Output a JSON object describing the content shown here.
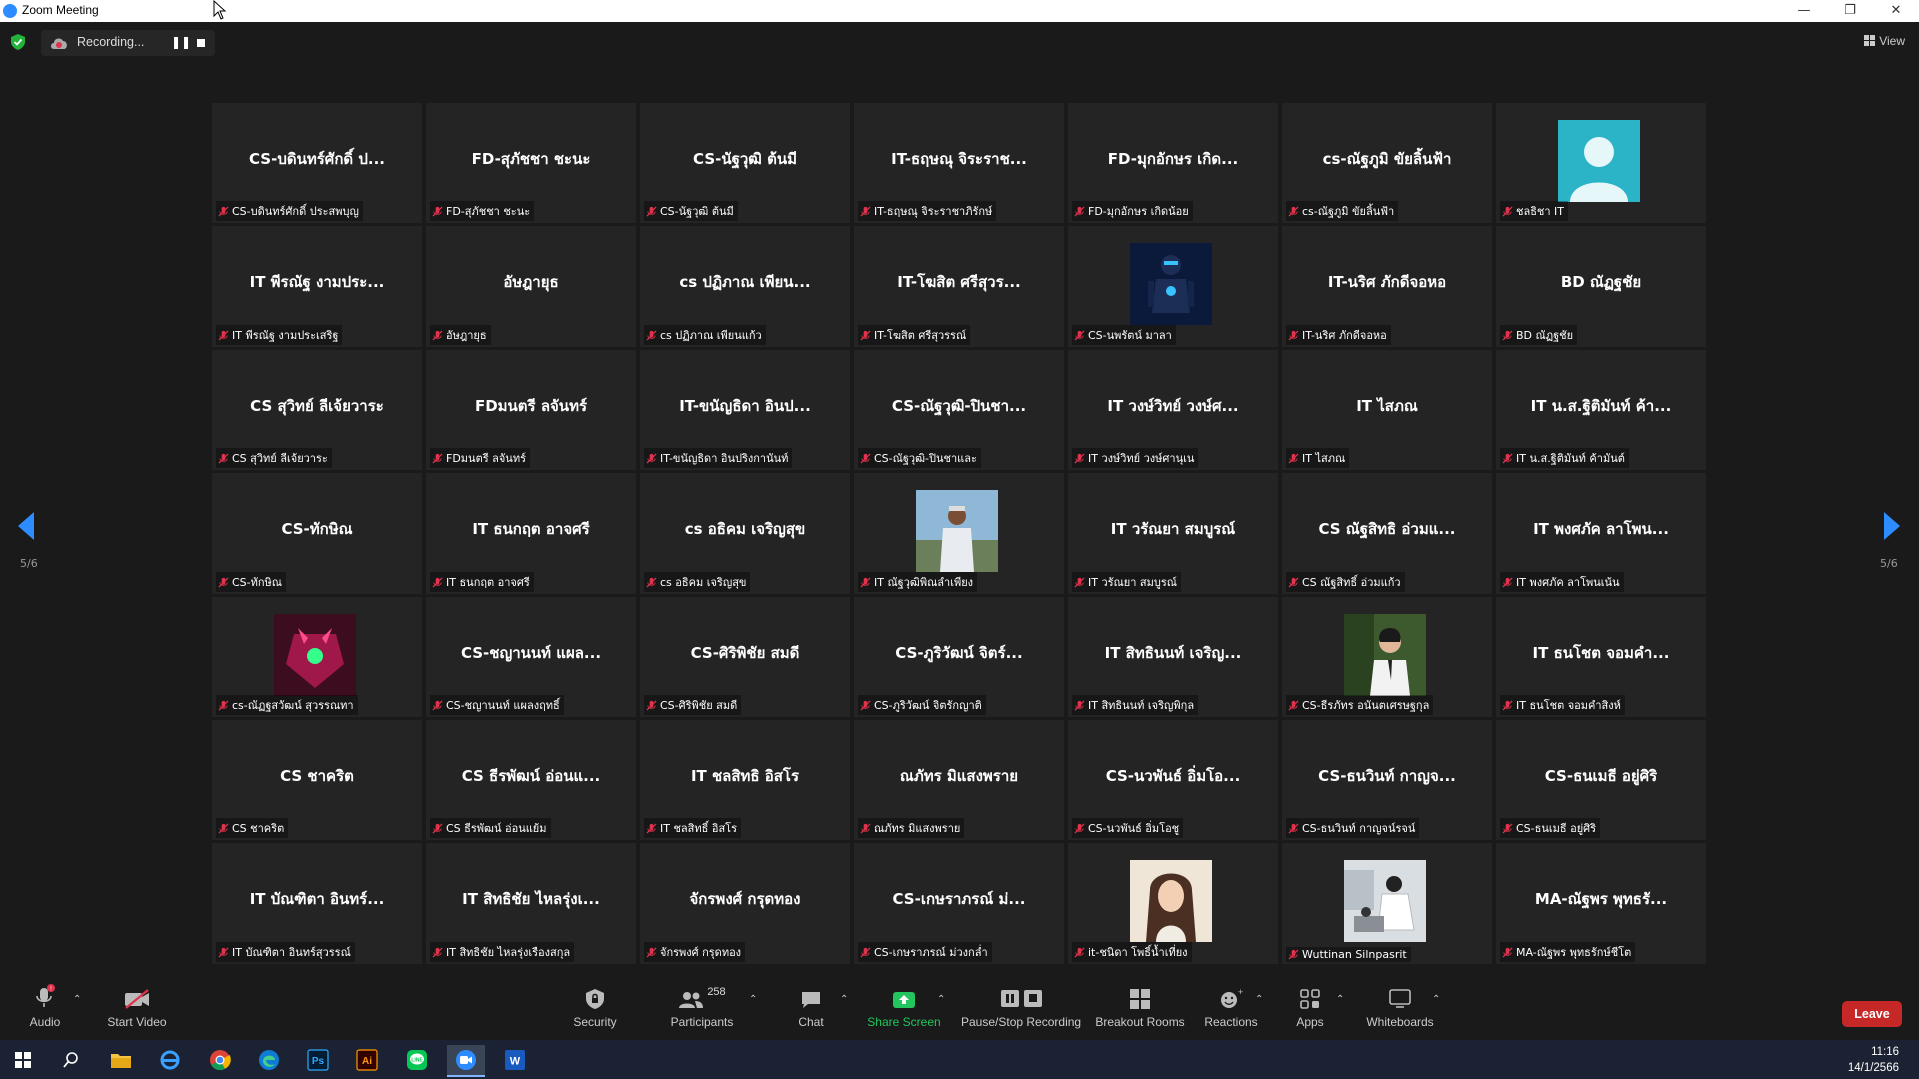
{
  "window": {
    "title": "Zoom Meeting"
  },
  "recording": {
    "label": "Recording..."
  },
  "view": {
    "label": "View"
  },
  "pager": {
    "left": "5/6",
    "right": "5/6"
  },
  "participants": [
    {
      "big": "CS-บดินทร์ศักดิ์ ป...",
      "label": "CS-บดินทร์ศักดิ์ ประสพบุญ"
    },
    {
      "big": "FD-สุภัชชา ชะนะ",
      "label": "FD-สุภัชชา ชะนะ"
    },
    {
      "big": "CS-นัฐวุฒิ ต้นมี",
      "label": "CS-นัฐวุฒิ ต้นมี"
    },
    {
      "big": "IT-ธฤษณุ จิระราช...",
      "label": "IT-ธฤษณุ จิระราชาภิรักษ์"
    },
    {
      "big": "FD-มุกอักษร เกิด...",
      "label": "FD-มุกอักษร เกิดน้อย"
    },
    {
      "big": "cs-ณัฐภูมิ ขัยลิ้นฟ้า",
      "label": "cs-ณัฐภูมิ ขัยลิ้นฟ้า"
    },
    {
      "big": "",
      "label": "ชลธิชา IT",
      "pic": "avatar"
    },
    {
      "big": "IT พีรณัฐ งามประ...",
      "label": "IT พีรณัฐ งามประเสริฐ"
    },
    {
      "big": "อัษฎายุธ",
      "label": "อัษฎายุธ"
    },
    {
      "big": "cs ปฏิภาณ เพียน...",
      "label": "cs ปฏิภาณ เพียนแก้ว"
    },
    {
      "big": "IT-โฆสิต ศรีสุวร...",
      "label": "IT-โฆสิต ศรีสุวรรณ์"
    },
    {
      "big": "",
      "label": "CS-นพรัตน์ มาลา",
      "pic": "robot"
    },
    {
      "big": "IT-นริศ ภักดีจอหอ",
      "label": "IT-นริศ ภักดีจอหอ"
    },
    {
      "big": "BD ณัฏฐชัย",
      "label": "BD ณัฏฐชัย"
    },
    {
      "big": "CS สุวิทย์ ลีเจ้ยวาระ",
      "label": "CS สุวิทย์ ลีเจ้ยวาระ"
    },
    {
      "big": "FDมนตรี ลจันทร์",
      "label": "FDมนตรี ลจันทร์"
    },
    {
      "big": "IT-ขนัญธิดา อินป...",
      "label": "IT-ขนัญธิดา อินปริงกานันท์"
    },
    {
      "big": "CS-ณัฐวุฒิ-ปินชา...",
      "label": "CS-ณัฐวุฒิ-ปินชาและ"
    },
    {
      "big": "IT วงษ์วิทย์ วงษ์ศ...",
      "label": "IT วงษ์วิทย์ วงษ์ศานุเน"
    },
    {
      "big": "IT ไสภณ",
      "label": "IT ไสภณ"
    },
    {
      "big": "IT น.ส.ฐิติมันท์ ค้า...",
      "label": "IT น.ส.ฐิติมันท์ ค้ามันต์"
    },
    {
      "big": "CS-ทักษิณ",
      "label": "CS-ทักษิณ"
    },
    {
      "big": "IT ธนกฤต อาจศรี",
      "label": "IT ธนกฤต อาจศรี"
    },
    {
      "big": "cs อธิคม เจริญสุข",
      "label": "cs อธิคม เจริญสุข"
    },
    {
      "big": "",
      "label": "IT ณัฐวุฒิพิณลำเพียง",
      "pic": "person"
    },
    {
      "big": "IT วรัณยา สมบูรณ์",
      "label": "IT วรัณยา สมบูรณ์"
    },
    {
      "big": "CS ณัฐสิทธิ อ่วมแ...",
      "label": "CS ณัฐสิทธิ์ อ่วมแก้ว"
    },
    {
      "big": "IT พงศภัค ลาโพน...",
      "label": "IT พงศภัค ลาโพนเน้น"
    },
    {
      "big": "",
      "label": "cs-ณัฏฐสวัฒน์ สุวรรณทา",
      "pic": "mech"
    },
    {
      "big": "CS-ชญานนท์ แผล...",
      "label": "CS-ชญานนท์ แผลงฤทธิ์"
    },
    {
      "big": "CS-ศิริพิชัย สมดี",
      "label": "CS-ศิริพิชัย สมดี"
    },
    {
      "big": "CS-ภูริวัฒน์ จิตร์...",
      "label": "CS-ภูริวัฒน์ จิตรักญาติ"
    },
    {
      "big": "IT สิทธินนท์ เจริญ...",
      "label": "IT สิทธินนท์ เจริญพิกุล"
    },
    {
      "big": "",
      "label": "CS-ธีรภัทร อนันตเศรษฐกุล",
      "pic": "suit"
    },
    {
      "big": "IT ธนโชต จอมคำ...",
      "label": "IT ธนโชต จอมคำสิงห์"
    },
    {
      "big": "CS ชาคริต",
      "label": "CS ชาคริต"
    },
    {
      "big": "CS ธีรพัฒน์ อ่อนแ...",
      "label": "CS ธีรพัฒน์ อ่อนแย้ม"
    },
    {
      "big": "IT ชลสิทธิ อิสโร",
      "label": "IT ชลสิทธิ์ อิสโร"
    },
    {
      "big": "ณภัทร มิแสงพราย",
      "label": "ณภัทร มิแสงพราย"
    },
    {
      "big": "CS-นวพันธ์ อิ่มโอ...",
      "label": "CS-นวพันธ์ อิ่มโอชู"
    },
    {
      "big": "CS-ธนวินท์ กาญจ...",
      "label": "CS-ธนวินท์ กาญจน์รจน์"
    },
    {
      "big": "CS-ธนเมธี อยู่ศิริ",
      "label": "CS-ธนเมธี อยู่ศิริ"
    },
    {
      "big": "IT บัณฑิตา อินทร์...",
      "label": "IT บัณฑิตา อินทร์สุวรรณ์"
    },
    {
      "big": "IT สิทธิชัย ไหลรุ่งเ...",
      "label": "IT สิทธิชัย ไหลรุ่งเรืองสกุล"
    },
    {
      "big": "จักรพงศ์ กรุดทอง",
      "label": "จักรพงศ์ กรุดทอง"
    },
    {
      "big": "CS-เกษราภรณ์ ม่...",
      "label": "CS-เกษราภรณ์ ม่วงกล่ำ"
    },
    {
      "big": "",
      "label": "it-ชนิดา โพธิ์น้ำเที่ยง",
      "pic": "girl"
    },
    {
      "big": "",
      "label": "Wuttinan Silnpasrit",
      "pic": "lab"
    },
    {
      "big": "MA-ณัฐพร พุทธรั...",
      "label": "MA-ณัฐพร พุทธรักษ์ชีโต"
    }
  ],
  "toolbar": {
    "audio": "Audio",
    "start_video": "Start Video",
    "security": "Security",
    "participants": "Participants",
    "participant_count": "258",
    "chat": "Chat",
    "share_screen": "Share Screen",
    "pause_stop": "Pause/Stop Recording",
    "breakout": "Breakout Rooms",
    "reactions": "Reactions",
    "apps": "Apps",
    "whiteboards": "Whiteboards",
    "leave": "Leave"
  },
  "taskbar": {
    "time": "11:16",
    "date": "14/1/2566",
    "apps": [
      "windows-start-icon",
      "search-icon",
      "file-explorer-icon",
      "ie-icon",
      "chrome-icon",
      "edge-icon",
      "photoshop-icon",
      "illustrator-icon",
      "line-icon",
      "zoom-icon",
      "word-icon"
    ]
  },
  "colors": {
    "accent": "#2d8cff",
    "share": "#22c55e",
    "leave": "#c62828",
    "muted": "#e0334d"
  }
}
